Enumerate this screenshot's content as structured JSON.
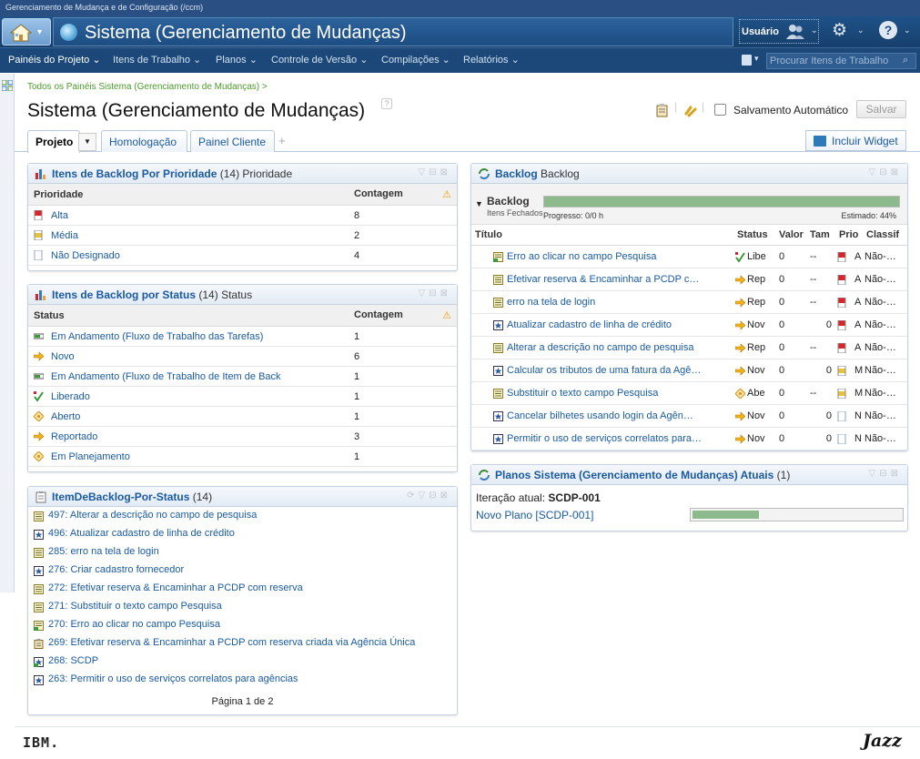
{
  "window": {
    "title": "Gerenciamento de Mudança e de Configuração (/ccm)"
  },
  "header": {
    "project_title": "Sistema (Gerenciamento de Mudanças)",
    "user_label": "Usuário"
  },
  "nav": {
    "items": [
      "Painéis do Projeto ⌄",
      "Itens de Trabalho ⌄",
      "Planos ⌄",
      "Controle de Versão ⌄",
      "Compilações ⌄",
      "Relatórios ⌄"
    ],
    "search_placeholder": "Procurar Itens de Trabalho"
  },
  "page": {
    "breadcrumb": "Todos os Painéis Sistema (Gerenciamento de Mudanças) >",
    "title": "Sistema (Gerenciamento de Mudanças)",
    "help": "?",
    "autosave_label": "Salvamento Automático",
    "save_label": "Salvar",
    "tabs": [
      "Projeto",
      "Homologação",
      "Painel Cliente"
    ],
    "add_widget_label": "Incluir Widget"
  },
  "widgets": {
    "priority": {
      "title": "Itens de Backlog Por Prioridade",
      "count": "(14)",
      "subtitle": "Prioridade",
      "col1": "Prioridade",
      "col2": "Contagem",
      "rows": [
        {
          "label": "Alta",
          "count": "8",
          "icon": "priority-high-icon",
          "color": "#d9242b"
        },
        {
          "label": "Média",
          "count": "2",
          "icon": "priority-medium-icon",
          "color": "#e8c23a"
        },
        {
          "label": "Não Designado",
          "count": "4",
          "icon": "priority-unassigned-icon",
          "color": "#8aa4c4"
        }
      ]
    },
    "status": {
      "title": "Itens de Backlog por Status",
      "count": "(14)",
      "subtitle": "Status",
      "col1": "Status",
      "col2": "Contagem",
      "rows": [
        {
          "label": "Em Andamento (Fluxo de Trabalho das Tarefas)",
          "count": "1",
          "icon": "in-progress-icon"
        },
        {
          "label": "Novo",
          "count": "6",
          "icon": "new-arrow-icon"
        },
        {
          "label": "Em Andamento (Fluxo de Trabalho de Item de Back",
          "count": "1",
          "icon": "in-progress-icon"
        },
        {
          "label": "Liberado",
          "count": "1",
          "icon": "released-check-icon"
        },
        {
          "label": "Aberto",
          "count": "1",
          "icon": "open-diamond-icon"
        },
        {
          "label": "Reportado",
          "count": "3",
          "icon": "reported-arrow-icon"
        },
        {
          "label": "Em Planejamento",
          "count": "1",
          "icon": "planning-diamond-icon"
        }
      ]
    },
    "itemlist": {
      "title": "ItemDeBacklog-Por-Status",
      "count": "(14)",
      "items": [
        {
          "text": "497: Alterar a descrição no campo de pesquisa",
          "icon": "task-icon"
        },
        {
          "text": "496: Atualizar cadastro de linha de crédito",
          "icon": "story-icon"
        },
        {
          "text": "285: erro na tela de login",
          "icon": "task-icon"
        },
        {
          "text": "276: Criar cadastro fornecedor",
          "icon": "story-icon"
        },
        {
          "text": "272: Efetivar reserva & Encaminhar a PCDP com reserva",
          "icon": "task-icon"
        },
        {
          "text": "271: Substituir o texto campo Pesquisa",
          "icon": "task-icon"
        },
        {
          "text": "270: Erro ao clicar no campo Pesquisa",
          "icon": "task-progress-icon"
        },
        {
          "text": "269: Efetivar reserva & Encaminhar a PCDP com reserva criada via Agência Única",
          "icon": "clipboard-icon"
        },
        {
          "text": "268: SCDP",
          "icon": "story-progress-icon"
        },
        {
          "text": "263: Permitir o uso de serviços correlatos para agências",
          "icon": "story-icon"
        }
      ],
      "pagination": "Página 1 de 2"
    },
    "backlog": {
      "title": "Backlog",
      "subtitle": "Backlog",
      "group_label": "Backlog",
      "closed_label": "Itens Fechados",
      "progress_text": "Progresso: 0/0 h",
      "estimated_text": "Estimado: 44%",
      "estimated_fraction": 0.44,
      "closed_fraction": 1.0,
      "columns": [
        "Título",
        "Status",
        "Valor",
        "Tam",
        "Prio",
        "Classif"
      ],
      "rows": [
        {
          "title": "Erro ao clicar no campo Pesquisa",
          "status": "Libe",
          "status_icon": "released-check-icon",
          "value": "0",
          "size": "--",
          "prio": "A",
          "prio_color": "#d9242b",
          "classif": "Não-…",
          "icon": "task-progress-icon"
        },
        {
          "title": "Efetivar reserva & Encaminhar a PCDP c…",
          "status": "Rep",
          "status_icon": "reported-arrow-icon",
          "value": "0",
          "size": "--",
          "prio": "A",
          "prio_color": "#d9242b",
          "classif": "Não-…",
          "icon": "task-icon"
        },
        {
          "title": "erro na tela de login",
          "status": "Rep",
          "status_icon": "reported-arrow-icon",
          "value": "0",
          "size": "--",
          "prio": "A",
          "prio_color": "#d9242b",
          "classif": "Não-…",
          "icon": "task-icon"
        },
        {
          "title": "Atualizar cadastro de linha de crédito",
          "status": "Nov",
          "status_icon": "new-arrow-icon",
          "value": "0",
          "size": "0",
          "prio": "A",
          "prio_color": "#d9242b",
          "classif": "Não-…",
          "icon": "story-icon"
        },
        {
          "title": "Alterar a descrição no campo de pesquisa",
          "status": "Rep",
          "status_icon": "reported-arrow-icon",
          "value": "0",
          "size": "--",
          "prio": "A",
          "prio_color": "#d9242b",
          "classif": "Não-…",
          "icon": "task-icon"
        },
        {
          "title": "Calcular os tributos de uma fatura da Agê…",
          "status": "Nov",
          "status_icon": "new-arrow-icon",
          "value": "0",
          "size": "0",
          "prio": "M",
          "prio_color": "#e8c23a",
          "classif": "Não-…",
          "icon": "story-icon"
        },
        {
          "title": "Substituir o texto campo Pesquisa",
          "status": "Abe",
          "status_icon": "open-diamond-icon",
          "value": "0",
          "size": "--",
          "prio": "M",
          "prio_color": "#e8c23a",
          "classif": "Não-…",
          "icon": "task-icon"
        },
        {
          "title": "Cancelar  bilhetes usando login da Agên…",
          "status": "Nov",
          "status_icon": "new-arrow-icon",
          "value": "0",
          "size": "0",
          "prio": "N",
          "prio_color": "#8aa4c4",
          "classif": "Não-…",
          "icon": "story-icon"
        },
        {
          "title": "Permitir o uso de serviços correlatos para…",
          "status": "Nov",
          "status_icon": "new-arrow-icon",
          "value": "0",
          "size": "0",
          "prio": "N",
          "prio_color": "#8aa4c4",
          "classif": "Não-…",
          "icon": "story-icon"
        }
      ]
    },
    "plans": {
      "title": "Planos Sistema (Gerenciamento de Mudanças) Atuais",
      "count": "(1)",
      "iteration_label": "Iteração atual:",
      "iteration_value": "SCDP-001",
      "plan_link": "Novo Plano [SCDP-001]",
      "plan_progress_fraction": 0.32
    }
  },
  "footer": {
    "left_logo": "IBM.",
    "right_logo": "Jazz"
  },
  "colors": {
    "header": "#1f5288",
    "nav": "#1b4878",
    "link": "#1a5aa0",
    "breadcrumb": "#4c9a2a",
    "progress": "#8dba8d"
  }
}
